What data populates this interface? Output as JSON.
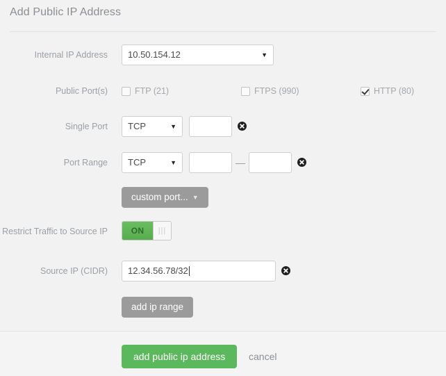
{
  "panel": {
    "title": "Add Public IP Address"
  },
  "form": {
    "internal_ip": {
      "label": "Internal IP Address",
      "value": "10.50.154.12"
    },
    "public_ports": {
      "label": "Public Port(s)",
      "options": [
        {
          "label": "FTP (21)",
          "checked": false
        },
        {
          "label": "FTPS (990)",
          "checked": false
        },
        {
          "label": "HTTP (80)",
          "checked": true
        }
      ]
    },
    "single_port": {
      "label": "Single Port",
      "protocol": "TCP",
      "port_value": "",
      "port_placeholder": "",
      "remove_icon": "remove-circle-icon"
    },
    "port_range": {
      "label": "Port Range",
      "protocol": "TCP",
      "from_value": "",
      "to_value": "",
      "separator": "—",
      "remove_icon": "remove-circle-icon"
    },
    "custom_port_button": {
      "label": "custom port...",
      "caret_icon": "caret-down-icon"
    },
    "restrict_traffic": {
      "label": "Restrict Traffic to Source IP",
      "state": "ON",
      "handle_icon": "grip-lines-icon"
    },
    "source_ip": {
      "label": "Source IP (CIDR)",
      "value": "12.34.56.78/32",
      "remove_icon": "remove-circle-icon"
    },
    "add_ip_range_button": {
      "label": "add ip range"
    }
  },
  "footer": {
    "submit_label": "add public ip address",
    "cancel_label": "cancel"
  },
  "colors": {
    "page_background": "#f2f2f2",
    "accent_green": "#5cb85c",
    "gray_button": "#9b9b9b",
    "label_text": "#9aa0a6",
    "field_border": "#cfcfcf"
  }
}
